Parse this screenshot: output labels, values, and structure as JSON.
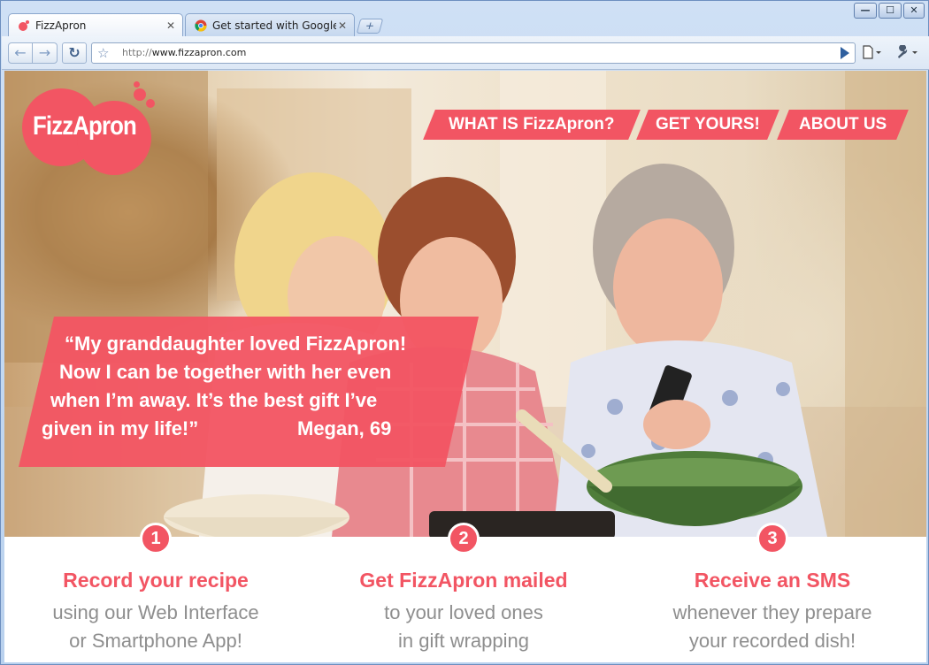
{
  "browser": {
    "tabs": [
      {
        "title": "FizzApron",
        "active": true
      },
      {
        "title": "Get started with Google ...",
        "active": false
      }
    ],
    "new_tab_symbol": "+",
    "window_controls": {
      "minimize": "—",
      "maximize": "☐",
      "close": "✕"
    },
    "nav": {
      "back": "←",
      "forward": "→",
      "reload": "↻"
    },
    "address": {
      "scheme": "http://",
      "host": "www.fizzapron.com"
    },
    "page_menu_icon": "page-menu-icon",
    "tools_menu_icon": "wrench-icon"
  },
  "site": {
    "logo_text": "FizzApron",
    "brand_color": "#f25563",
    "nav": [
      {
        "label": "WHAT IS FizzApron?"
      },
      {
        "label": "GET YOURS!"
      },
      {
        "label": "ABOUT US"
      }
    ],
    "quote": {
      "lines": [
        "“My granddaughter loved FizzApron!",
        "Now I can be together with her even",
        "when I’m away. It’s the best gift I’ve",
        "given in my life!”"
      ],
      "author": "Megan, 69"
    },
    "steps": [
      {
        "number": "1",
        "title": "Record your recipe",
        "desc": [
          "using our Web Interface",
          "or Smartphone App!"
        ]
      },
      {
        "number": "2",
        "title": "Get FizzApron mailed",
        "desc": [
          "to your loved ones",
          "in gift wrapping"
        ]
      },
      {
        "number": "3",
        "title": "Receive an SMS",
        "desc": [
          "whenever they prepare",
          "your recorded dish!"
        ]
      }
    ]
  }
}
